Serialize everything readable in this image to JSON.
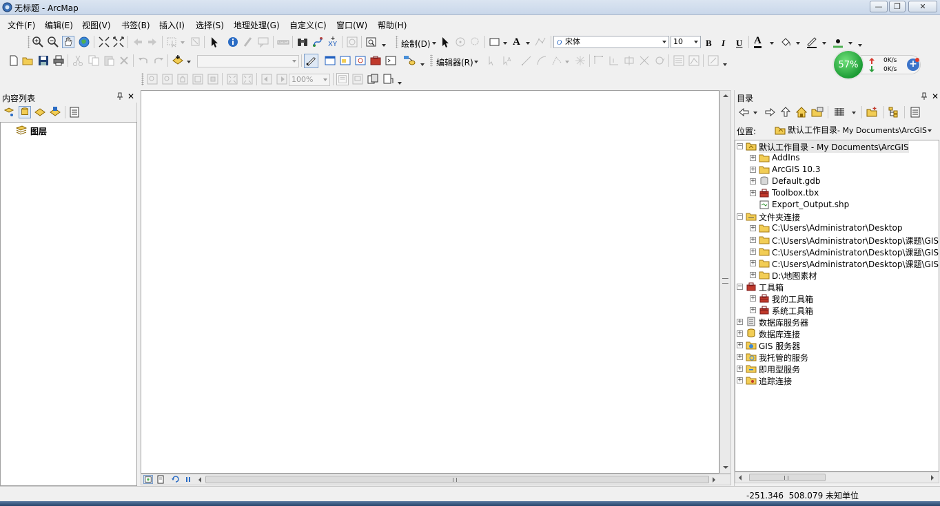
{
  "window": {
    "title": "无标题 - ArcMap",
    "minimize_glyph": "—",
    "maximize_glyph": "❐",
    "close_glyph": "✕"
  },
  "menubar": {
    "items": [
      {
        "label": "文件(F)"
      },
      {
        "label": "编辑(E)"
      },
      {
        "label": "视图(V)"
      },
      {
        "label": "书签(B)"
      },
      {
        "label": "插入(I)"
      },
      {
        "label": "选择(S)"
      },
      {
        "label": "地理处理(G)"
      },
      {
        "label": "自定义(C)"
      },
      {
        "label": "窗口(W)"
      },
      {
        "label": "帮助(H)"
      }
    ]
  },
  "toolbar": {
    "draw_label": "绘制(D)",
    "font_name": "宋体",
    "font_size": "10",
    "bold": "B",
    "italic": "I",
    "underline": "U",
    "font_color_glyph": "A",
    "text_tool_glyph": "A",
    "editor_label": "编辑器(R)",
    "layout_zoom": "100%",
    "scale_value": ""
  },
  "net_widget": {
    "percent": "57%",
    "upload": "0K/s",
    "download": "0K/s",
    "plus": "+"
  },
  "toc": {
    "title": "内容列表",
    "pin": "ᚌ",
    "close": "✕",
    "root_label": "图层"
  },
  "catalog": {
    "title": "目录",
    "pin": "ᚌ",
    "close": "✕",
    "location_label": "位置:",
    "location_value_main": "默认工作目录",
    "location_value_sub": " - My Documents\\ArcGIS",
    "tree": [
      {
        "label": "默认工作目录 - My Documents\\ArcGIS",
        "level": 0,
        "expander": "−",
        "icon": "home-folder-icon"
      },
      {
        "label": "AddIns",
        "level": 1,
        "expander": "+",
        "icon": "folder-icon"
      },
      {
        "label": "ArcGIS 10.3",
        "level": 1,
        "expander": "+",
        "icon": "folder-icon"
      },
      {
        "label": "Default.gdb",
        "level": 1,
        "expander": "+",
        "icon": "geodatabase-icon"
      },
      {
        "label": "Toolbox.tbx",
        "level": 1,
        "expander": "+",
        "icon": "toolbox-icon"
      },
      {
        "label": "Export_Output.shp",
        "level": 1,
        "expander": "",
        "icon": "shapefile-icon"
      },
      {
        "label": "文件夹连接",
        "level": 0,
        "expander": "−",
        "icon": "folder-connection-icon"
      },
      {
        "label": "C:\\Users\\Administrator\\Desktop",
        "level": 1,
        "expander": "+",
        "icon": "folder-icon"
      },
      {
        "label": "C:\\Users\\Administrator\\Desktop\\课题\\GIS",
        "level": 1,
        "expander": "+",
        "icon": "folder-icon"
      },
      {
        "label": "C:\\Users\\Administrator\\Desktop\\课题\\GIS",
        "level": 1,
        "expander": "+",
        "icon": "folder-icon"
      },
      {
        "label": "C:\\Users\\Administrator\\Desktop\\课题\\GIS",
        "level": 1,
        "expander": "+",
        "icon": "folder-icon"
      },
      {
        "label": "D:\\地图素材",
        "level": 1,
        "expander": "+",
        "icon": "folder-icon"
      },
      {
        "label": "工具箱",
        "level": 0,
        "expander": "−",
        "icon": "toolbox-folder-icon"
      },
      {
        "label": "我的工具箱",
        "level": 1,
        "expander": "+",
        "icon": "toolbox-icon"
      },
      {
        "label": "系统工具箱",
        "level": 1,
        "expander": "+",
        "icon": "toolbox-icon"
      },
      {
        "label": "数据库服务器",
        "level": 0,
        "expander": "+",
        "icon": "database-server-icon"
      },
      {
        "label": "数据库连接",
        "level": 0,
        "expander": "+",
        "icon": "database-connection-icon"
      },
      {
        "label": "GIS 服务器",
        "level": 0,
        "expander": "+",
        "icon": "gis-server-icon"
      },
      {
        "label": "我托管的服务",
        "level": 0,
        "expander": "+",
        "icon": "hosted-services-icon"
      },
      {
        "label": "即用型服务",
        "level": 0,
        "expander": "+",
        "icon": "ready-services-icon"
      },
      {
        "label": "追踪连接",
        "level": 0,
        "expander": "+",
        "icon": "tracking-connection-icon"
      }
    ]
  },
  "statusbar": {
    "coordinates": "-251.346  508.079 未知单位"
  },
  "colors": {
    "folder": "#f2cd55",
    "toolbox_red": "#c0392b",
    "accent_blue": "#1f5fbf",
    "widget_green": "#1c9c34"
  }
}
